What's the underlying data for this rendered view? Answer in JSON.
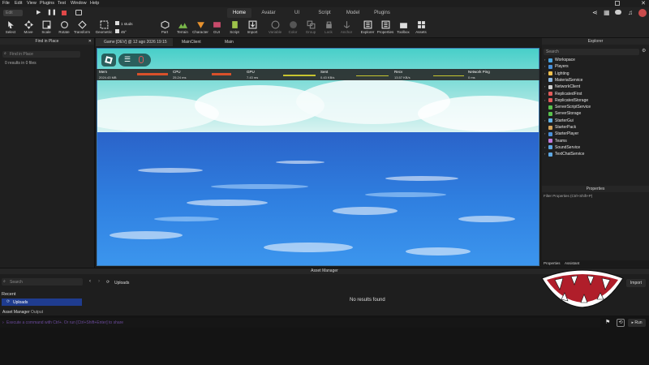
{
  "menubar": {
    "items": [
      "File",
      "Edit",
      "View",
      "Plugins",
      "Test",
      "Window",
      "Help"
    ]
  },
  "ribbon": {
    "mode": "Edit",
    "tabs": [
      "Home",
      "Avatar",
      "UI",
      "Script",
      "Model",
      "Plugins"
    ],
    "active_tab": "Home",
    "tools": [
      "Select",
      "Move",
      "Scale",
      "Rotate",
      "Transform",
      "Geometric",
      "Part",
      "Terrain",
      "Character",
      "GUI",
      "Script",
      "Import",
      "Variable",
      "Color",
      "Group",
      "Lock",
      "Anchor",
      "Explorer",
      "Properties",
      "Toolbox",
      "Assets"
    ],
    "snap_studs": "1 studs",
    "snap_degrees": "45°"
  },
  "find_in_place": {
    "title": "Find in Place",
    "placeholder": "Find in Place",
    "result": "0 results in 0 files"
  },
  "viewport_tabs": [
    "Game [DEV] @ 12 ago 2026 19:15",
    "MainClient",
    "Main"
  ],
  "stats": [
    {
      "label": "Mem",
      "value": "2024.43 MB"
    },
    {
      "label": "CPU",
      "value": "25.24 ms"
    },
    {
      "label": "GPU",
      "value": "7.43 ms"
    },
    {
      "label": "Sent",
      "value": "0.43 KB/s"
    },
    {
      "label": "Recv",
      "value": "13.57 KB/s"
    },
    {
      "label": "Network Ping",
      "value": "0 ms"
    }
  ],
  "explorer": {
    "title": "Explorer",
    "search_placeholder": "Search",
    "items": [
      {
        "name": "Workspace",
        "color": "#4aa3df",
        "expandable": true
      },
      {
        "name": "Players",
        "color": "#4a90d9",
        "expandable": true
      },
      {
        "name": "Lighting",
        "color": "#f2c14e",
        "expandable": true
      },
      {
        "name": "MaterialService",
        "color": "#8fb8e0",
        "expandable": false
      },
      {
        "name": "NetworkClient",
        "color": "#d0d0d0",
        "expandable": true
      },
      {
        "name": "ReplicatedFirst",
        "color": "#e35b5b",
        "expandable": true
      },
      {
        "name": "ReplicatedStorage",
        "color": "#e35b5b",
        "expandable": true
      },
      {
        "name": "ServerScriptService",
        "color": "#59c14d",
        "expandable": false
      },
      {
        "name": "ServerStorage",
        "color": "#59c14d",
        "expandable": false
      },
      {
        "name": "StarterGui",
        "color": "#62b3e8",
        "expandable": true
      },
      {
        "name": "StarterPack",
        "color": "#d6a45b",
        "expandable": false
      },
      {
        "name": "StarterPlayer",
        "color": "#4a90d9",
        "expandable": true
      },
      {
        "name": "Teams",
        "color": "#c27ad9",
        "expandable": false
      },
      {
        "name": "SoundService",
        "color": "#5fa8e3",
        "expandable": true
      },
      {
        "name": "TextChatService",
        "color": "#5fa8e3",
        "expandable": true
      }
    ]
  },
  "properties": {
    "title": "Properties",
    "filter_placeholder": "Filter Properties (Ctrl+Shift+P)",
    "tabs": [
      "Properties",
      "Assistant"
    ]
  },
  "asset_manager": {
    "title": "Asset Manager",
    "search_placeholder": "Search",
    "recent_label": "Recent",
    "selected_folder": "Uploads",
    "breadcrumb": "Uploads",
    "empty_text": "No results found",
    "import_label": "Import"
  },
  "output": {
    "tabs": [
      "Asset Manager",
      "Output"
    ],
    "command_placeholder": "Execute a command with Ctrl+. Or run [Ctrl+Shift+Enter] to share",
    "run_label": "Run"
  }
}
